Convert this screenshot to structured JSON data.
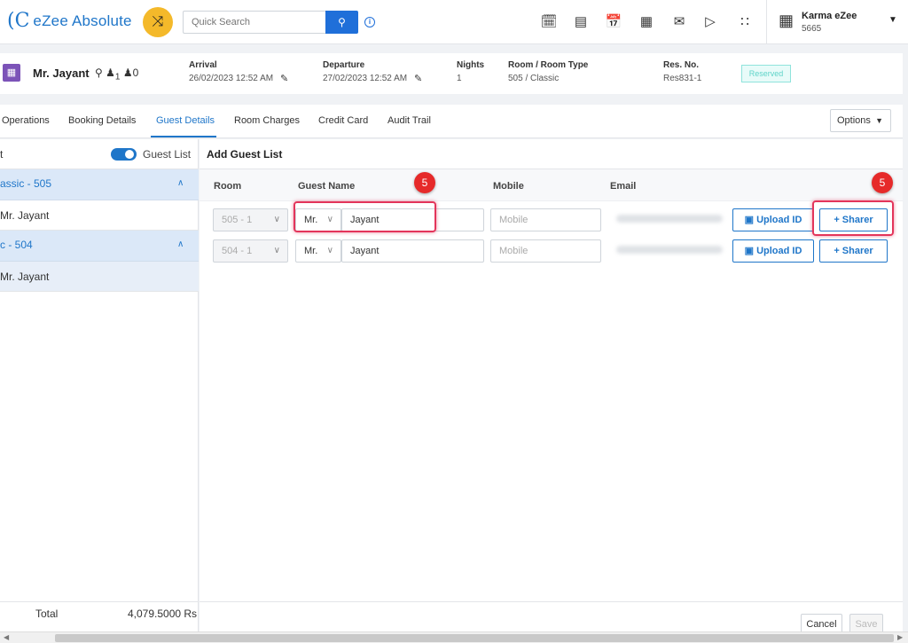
{
  "app": {
    "logo_mark": "(C",
    "title": "eZee Absolute",
    "shuffle_icon": "shuffle-icon"
  },
  "search": {
    "placeholder": "Quick Search"
  },
  "top_icons": [
    "calendar-plus-icon",
    "room-view-icon",
    "calendar-icon",
    "billing-icon",
    "mail-icon",
    "megaphone-icon",
    "apps-grid-icon"
  ],
  "property": {
    "name": "Karma eZee",
    "id": "5665"
  },
  "reservation": {
    "guest_name": "Mr. Jayant",
    "adults": "1",
    "children": "0",
    "arrival_label": "Arrival",
    "arrival_value": "26/02/2023 12:52 AM",
    "departure_label": "Departure",
    "departure_value": "27/02/2023 12:52 AM",
    "nights_label": "Nights",
    "nights_value": "1",
    "room_label": "Room / Room Type",
    "room_value": "505 / Classic",
    "resno_label": "Res. No.",
    "resno_value": "Res831-1",
    "status": "Reserved"
  },
  "tabs": [
    "Operations",
    "Booking Details",
    "Guest Details",
    "Room Charges",
    "Credit Card",
    "Audit Trail"
  ],
  "active_tab": "Guest Details",
  "options_label": "Options",
  "left_panel": {
    "partial_label": "t",
    "toggle_label": "Guest List",
    "groups": [
      {
        "title": "assic - 505",
        "guest": "Mr. Jayant"
      },
      {
        "title": "c - 504",
        "guest": "Mr. Jayant"
      }
    ],
    "total_label": "Total",
    "total_value": "4,079.5000 Rs"
  },
  "guest_list": {
    "title": "Add Guest List",
    "headers": {
      "room": "Room",
      "guest_name": "Guest Name",
      "mobile": "Mobile",
      "email": "Email"
    },
    "rows": [
      {
        "room": "505 - 1",
        "salutation": "Mr.",
        "name": "Jayant",
        "mobile_placeholder": "Mobile",
        "upload_label": "Upload ID",
        "sharer_label": "+ Sharer"
      },
      {
        "room": "504 - 1",
        "salutation": "Mr.",
        "name": "Jayant",
        "mobile_placeholder": "Mobile",
        "upload_label": "Upload ID",
        "sharer_label": "+ Sharer"
      }
    ]
  },
  "annotations": {
    "marker_1": "5",
    "marker_2": "5",
    "highlight_color": "#e3355b"
  },
  "footer": {
    "cancel_label": "Cancel",
    "save_label": "Save"
  },
  "colors": {
    "accent": "#1f76c9",
    "shuffle": "#f4b92a",
    "room_icon": "#7c53b8",
    "marker": "#e62a2a"
  }
}
